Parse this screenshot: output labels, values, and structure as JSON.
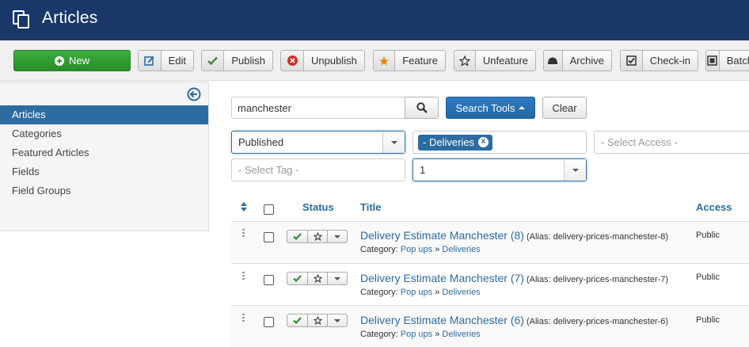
{
  "header": {
    "title": "Articles"
  },
  "toolbar": {
    "new_label": "New",
    "edit_label": "Edit",
    "publish_label": "Publish",
    "unpublish_label": "Unpublish",
    "feature_label": "Feature",
    "unfeature_label": "Unfeature",
    "archive_label": "Archive",
    "checkin_label": "Check-in",
    "batch_label": "Batch"
  },
  "sidebar": {
    "items": [
      {
        "label": "Articles"
      },
      {
        "label": "Categories"
      },
      {
        "label": "Featured Articles"
      },
      {
        "label": "Fields"
      },
      {
        "label": "Field Groups"
      }
    ]
  },
  "search": {
    "value": "manchester",
    "search_tools_label": "Search Tools",
    "clear_label": "Clear"
  },
  "filters": {
    "status_value": "Published",
    "category_chip": "- Deliveries",
    "access_placeholder": "- Select Access -",
    "tag_placeholder": "- Select Tag -",
    "level_value": "1"
  },
  "table": {
    "headers": {
      "status": "Status",
      "title": "Title",
      "access": "Access"
    },
    "rows": [
      {
        "title": "Delivery Estimate Manchester (8)",
        "alias": "(Alias: delivery-prices-manchester-8)",
        "category_label": "Category:",
        "cat_parent": "Pop ups",
        "sep": "»",
        "cat_child": "Deliveries",
        "access": "Public"
      },
      {
        "title": "Delivery Estimate Manchester (7)",
        "alias": "(Alias: delivery-prices-manchester-7)",
        "category_label": "Category:",
        "cat_parent": "Pop ups",
        "sep": "»",
        "cat_child": "Deliveries",
        "access": "Public"
      },
      {
        "title": "Delivery Estimate Manchester (6)",
        "alias": "(Alias: delivery-prices-manchester-6)",
        "category_label": "Category:",
        "cat_parent": "Pop ups",
        "sep": "»",
        "cat_child": "Deliveries",
        "access": "Public"
      }
    ]
  },
  "colors": {
    "header_bg": "#1a3867",
    "accent": "#2d6ca2",
    "new_green": "#2f9a2f",
    "publish_check": "#3a8a3a",
    "unpublish_red": "#c9302c",
    "feature_star": "#e3890a"
  },
  "icons": [
    "articles-stack-icon",
    "plus-circle-icon",
    "edit-icon",
    "check-icon",
    "x-circle-icon",
    "star-icon",
    "star-outline-icon",
    "archive-icon",
    "checkbox-check-icon",
    "batch-icon",
    "collapse-arrow-icon",
    "search-icon",
    "sort-icon",
    "drag-handle-icon",
    "chevron-down-icon"
  ]
}
